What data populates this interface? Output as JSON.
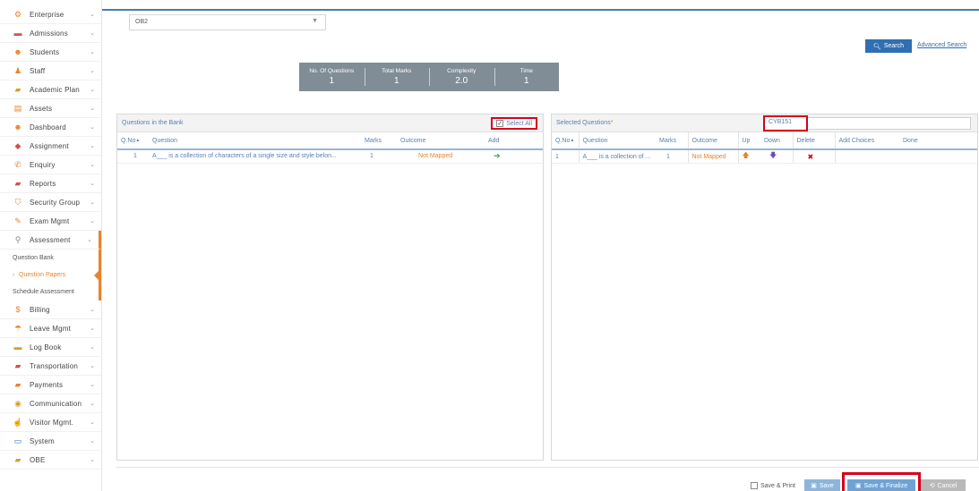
{
  "sidebar": {
    "items": [
      {
        "label": "Enterprise",
        "icon": "gears-icon",
        "color": "#e8832c"
      },
      {
        "label": "Admissions",
        "icon": "book-icon",
        "color": "#d2504b"
      },
      {
        "label": "Students",
        "icon": "users-icon",
        "color": "#e8832c"
      },
      {
        "label": "Staff",
        "icon": "user-icon",
        "color": "#e8832c"
      },
      {
        "label": "Academic Plan",
        "icon": "folder-icon",
        "color": "#d4a02a"
      },
      {
        "label": "Assets",
        "icon": "table-icon",
        "color": "#e8832c"
      },
      {
        "label": "Dashboard",
        "icon": "group-icon",
        "color": "#e8832c"
      },
      {
        "label": "Assignment",
        "icon": "tag-icon",
        "color": "#d2504b"
      },
      {
        "label": "Enquiry",
        "icon": "phone-icon",
        "color": "#e8832c"
      },
      {
        "label": "Reports",
        "icon": "folder-open-icon",
        "color": "#d2504b"
      },
      {
        "label": "Security Group",
        "icon": "shield-icon",
        "color": "#e8832c"
      },
      {
        "label": "Exam Mgmt",
        "icon": "edit-icon",
        "color": "#e8832c"
      },
      {
        "label": "Assessment",
        "icon": "search-icon",
        "color": "#888888"
      }
    ],
    "sub_items": [
      {
        "label": "Question Bank"
      },
      {
        "label": "Question Papers"
      },
      {
        "label": "Schedule Assessment"
      }
    ],
    "items_after": [
      {
        "label": "Billing",
        "icon": "dollar-icon",
        "color": "#e8832c"
      },
      {
        "label": "Leave Mgmt",
        "icon": "umbrella-icon",
        "color": "#e8832c"
      },
      {
        "label": "Log Book",
        "icon": "book-icon",
        "color": "#d4a02a"
      },
      {
        "label": "Transportation",
        "icon": "bus-icon",
        "color": "#d2504b"
      },
      {
        "label": "Payments",
        "icon": "briefcase-icon",
        "color": "#e8832c"
      },
      {
        "label": "Communication",
        "icon": "broadcast-icon",
        "color": "#d4a02a"
      },
      {
        "label": "Visitor Mgmt.",
        "icon": "thumbs-up-icon",
        "color": "#e8832c"
      },
      {
        "label": "System",
        "icon": "monitor-icon",
        "color": "#2f6fb3"
      },
      {
        "label": "OBE",
        "icon": "folder-icon",
        "color": "#d4a02a"
      }
    ]
  },
  "filter": {
    "class_value": "OB2"
  },
  "search": {
    "button_label": "Search",
    "advanced_label": "Advanced Search"
  },
  "stats": [
    {
      "title": "No. Of Questions",
      "value": "1"
    },
    {
      "title": "Total Marks",
      "value": "1"
    },
    {
      "title": "Complexity",
      "value": "2.0"
    },
    {
      "title": "Time",
      "value": "1"
    }
  ],
  "bank": {
    "title": "Questions in the Bank",
    "select_all_label": "Select All",
    "headers": [
      "Q.No",
      "Question",
      "Marks",
      "Outcome",
      "Add"
    ],
    "rows": [
      {
        "qno": "1",
        "question": "A___ is a collection of characters of a single size and style belon...",
        "marks": "1",
        "outcome": "Not Mapped"
      }
    ]
  },
  "selected": {
    "title": "Selected Questions",
    "required_mark": "*",
    "code_value": "CYB151",
    "headers": [
      "Q.No",
      "Question",
      "Marks",
      "Outcome",
      "Up",
      "Down",
      "Delete",
      "Add Choices",
      "Done"
    ],
    "rows": [
      {
        "qno": "1",
        "question": "A___ is a collection of ...",
        "marks": "1",
        "outcome": "Not Mapped"
      }
    ]
  },
  "footer": {
    "save_print_label": "Save & Print",
    "save_label": "Save",
    "save_finalize_label": "Save & Finalize",
    "cancel_label": "Cancel"
  }
}
